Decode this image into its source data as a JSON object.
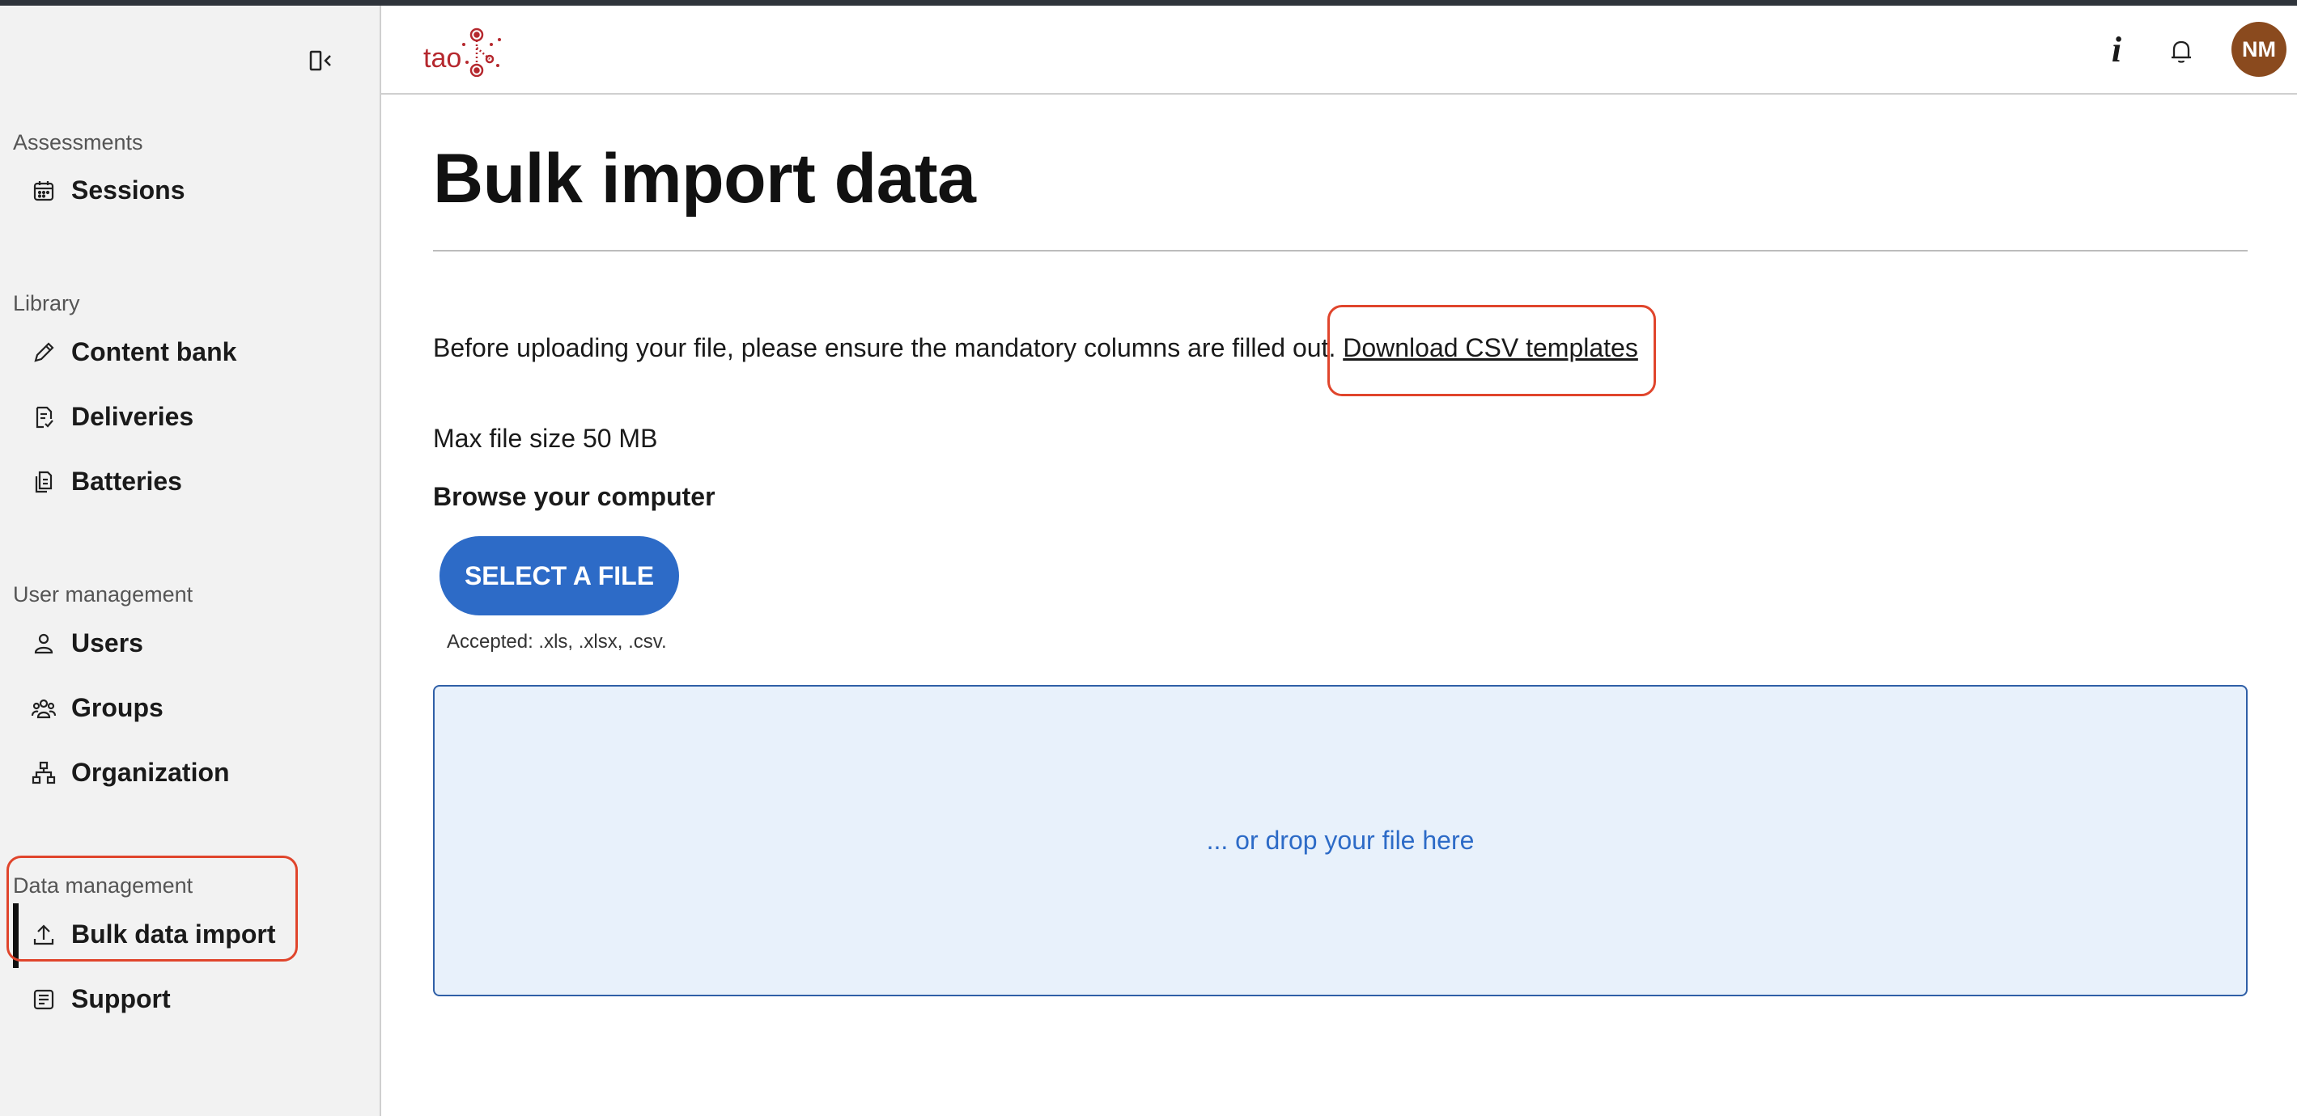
{
  "app": {
    "logo_text": "tao"
  },
  "header": {
    "info_icon": "i",
    "user_initials": "NM"
  },
  "sidebar": {
    "sections": [
      {
        "title": "Assessments",
        "items": [
          {
            "label": "Sessions",
            "icon": "calendar-icon"
          }
        ]
      },
      {
        "title": "Library",
        "items": [
          {
            "label": "Content bank",
            "icon": "pencil-icon"
          },
          {
            "label": "Deliveries",
            "icon": "delivery-icon"
          },
          {
            "label": "Batteries",
            "icon": "battery-doc-icon"
          }
        ]
      },
      {
        "title": "User management",
        "items": [
          {
            "label": "Users",
            "icon": "user-icon"
          },
          {
            "label": "Groups",
            "icon": "group-icon"
          },
          {
            "label": "Organization",
            "icon": "org-icon"
          }
        ]
      },
      {
        "title": "Data management",
        "items": [
          {
            "label": "Bulk data import",
            "icon": "upload-icon",
            "active": true
          },
          {
            "label": "Support",
            "icon": "support-icon"
          }
        ]
      }
    ]
  },
  "main": {
    "title": "Bulk import data",
    "intro_text": "Before uploading your file, please ensure the mandatory columns are filled out. ",
    "download_link": "Download CSV templates",
    "max_size": "Max file size 50 MB",
    "browse_label": "Browse your computer",
    "select_button": "SELECT A FILE",
    "accepted": "Accepted: .xls, .xlsx, .csv.",
    "dropzone_text": "... or drop your file here"
  },
  "colors": {
    "accent": "#2d6bc7",
    "avatar": "#8a4a1e",
    "annotation": "#e0452c"
  }
}
